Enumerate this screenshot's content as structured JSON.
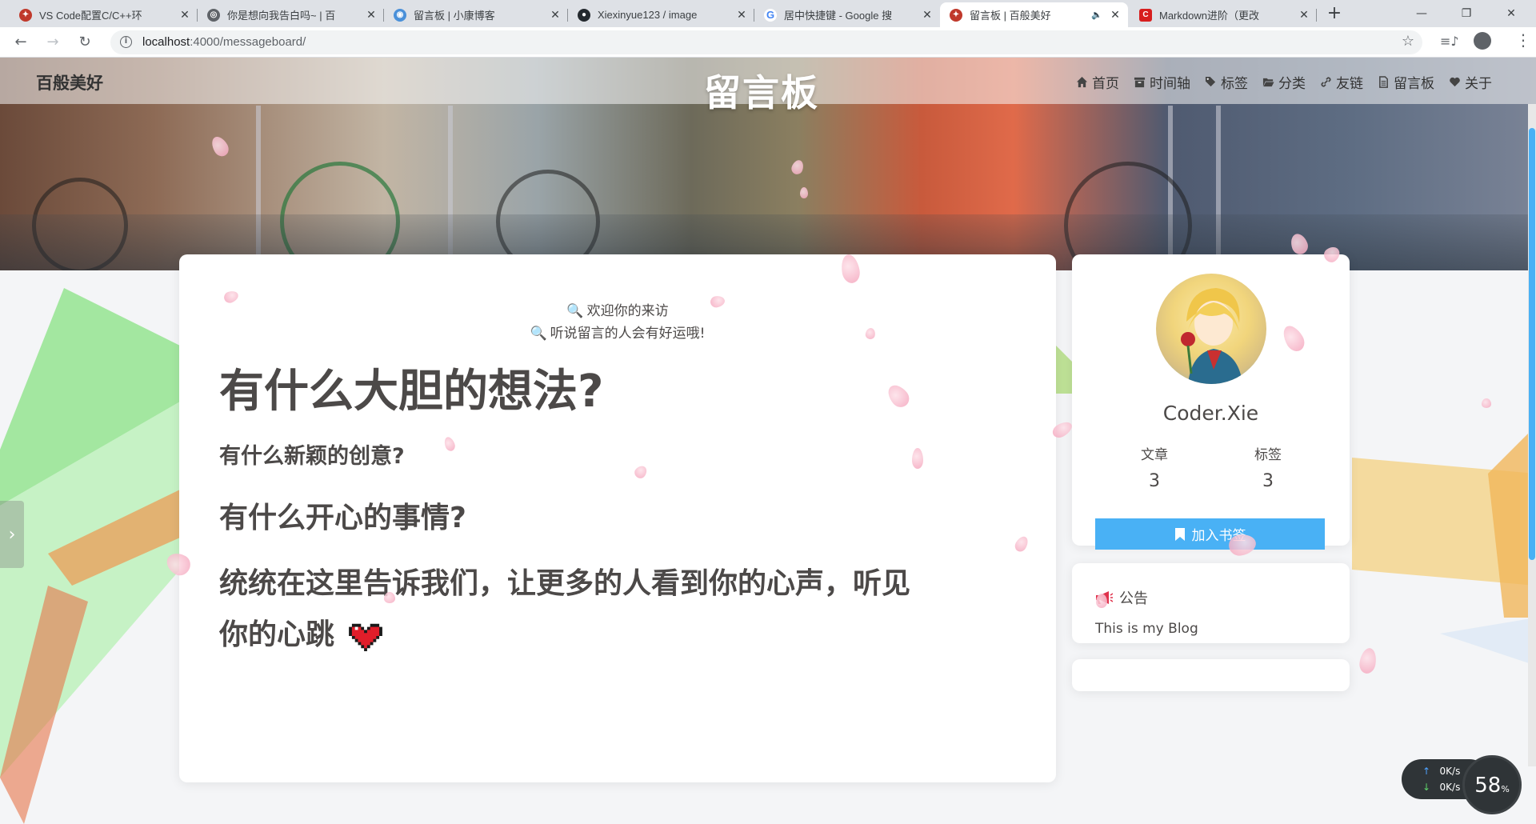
{
  "browser": {
    "tabs": [
      {
        "title": "VS Code配置C/C++环",
        "favicon_color": "#c0392b",
        "active": false
      },
      {
        "title": "你是想向我告白吗~ | 百",
        "favicon_color": "#5f6368",
        "active": false
      },
      {
        "title": "留言板 | 小康博客",
        "favicon_color": "#4a90d9",
        "active": false
      },
      {
        "title": "Xiexinyue123 / image",
        "favicon_color": "#24292e",
        "active": false
      },
      {
        "title": "居中快捷键 - Google 搜",
        "favicon_color": "#4285f4",
        "active": false
      },
      {
        "title": "留言板 | 百般美好",
        "favicon_color": "#c0392b",
        "active": true,
        "audio": true
      },
      {
        "title": "Markdown进阶（更改",
        "favicon_color": "#d71e1e",
        "active": false
      }
    ],
    "new_tab": "+",
    "window_buttons": {
      "minimize": "—",
      "maximize": "❐",
      "close": "✕"
    },
    "url": "localhost:4000/messageboard/",
    "url_host": "localhost",
    "url_rest": ":4000/messageboard/"
  },
  "site": {
    "brand": "百般美好",
    "page_title": "留言板",
    "menu": [
      {
        "label": "首页",
        "icon": "home-icon"
      },
      {
        "label": "时间轴",
        "icon": "archive-icon"
      },
      {
        "label": "标签",
        "icon": "tags-icon"
      },
      {
        "label": "分类",
        "icon": "folder-open-icon"
      },
      {
        "label": "友链",
        "icon": "link-icon"
      },
      {
        "label": "留言板",
        "icon": "file-icon"
      },
      {
        "label": "关于",
        "icon": "heart-icon"
      }
    ]
  },
  "content": {
    "welcome_lines": [
      "欢迎你的来访",
      "听说留言的人会有好运哦!"
    ],
    "heading1": "有什么大胆的想法?",
    "heading2": "有什么新颖的创意?",
    "heading3": "有什么开心的事情?",
    "heading4_line1": "统统在这里告诉我们，让更多的人看到你的心声，听见",
    "heading4_line2": "你的心跳"
  },
  "profile": {
    "author": "Coder.Xie",
    "stats": [
      {
        "label": "文章",
        "value": "3"
      },
      {
        "label": "标签",
        "value": "3"
      }
    ],
    "bookmark_label": "加入书签",
    "socials": [
      "github-icon",
      "envelope-icon",
      "rss-icon"
    ]
  },
  "notice": {
    "title": "公告",
    "text": "This is my Blog"
  },
  "net_monitor": {
    "upload": "0K/s",
    "download": "0K/s",
    "percent": "58",
    "percent_unit": "%"
  },
  "colors": {
    "accent": "#49b1f5",
    "text": "#4c4948",
    "notice_icon": "#e0314b"
  }
}
